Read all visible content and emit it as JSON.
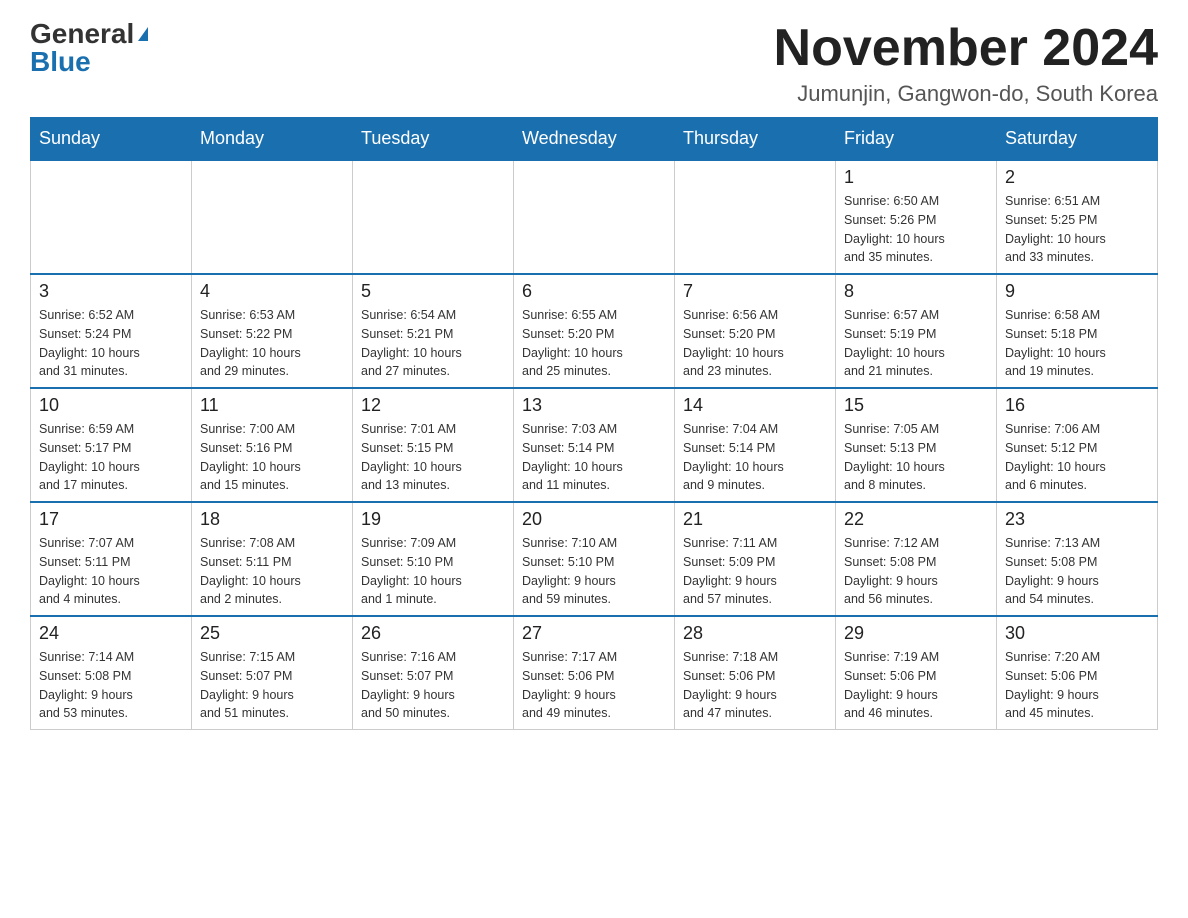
{
  "logo": {
    "general": "General",
    "blue": "Blue"
  },
  "title": "November 2024",
  "location": "Jumunjin, Gangwon-do, South Korea",
  "weekdays": [
    "Sunday",
    "Monday",
    "Tuesday",
    "Wednesday",
    "Thursday",
    "Friday",
    "Saturday"
  ],
  "weeks": [
    [
      {
        "day": "",
        "info": ""
      },
      {
        "day": "",
        "info": ""
      },
      {
        "day": "",
        "info": ""
      },
      {
        "day": "",
        "info": ""
      },
      {
        "day": "",
        "info": ""
      },
      {
        "day": "1",
        "info": "Sunrise: 6:50 AM\nSunset: 5:26 PM\nDaylight: 10 hours\nand 35 minutes."
      },
      {
        "day": "2",
        "info": "Sunrise: 6:51 AM\nSunset: 5:25 PM\nDaylight: 10 hours\nand 33 minutes."
      }
    ],
    [
      {
        "day": "3",
        "info": "Sunrise: 6:52 AM\nSunset: 5:24 PM\nDaylight: 10 hours\nand 31 minutes."
      },
      {
        "day": "4",
        "info": "Sunrise: 6:53 AM\nSunset: 5:22 PM\nDaylight: 10 hours\nand 29 minutes."
      },
      {
        "day": "5",
        "info": "Sunrise: 6:54 AM\nSunset: 5:21 PM\nDaylight: 10 hours\nand 27 minutes."
      },
      {
        "day": "6",
        "info": "Sunrise: 6:55 AM\nSunset: 5:20 PM\nDaylight: 10 hours\nand 25 minutes."
      },
      {
        "day": "7",
        "info": "Sunrise: 6:56 AM\nSunset: 5:20 PM\nDaylight: 10 hours\nand 23 minutes."
      },
      {
        "day": "8",
        "info": "Sunrise: 6:57 AM\nSunset: 5:19 PM\nDaylight: 10 hours\nand 21 minutes."
      },
      {
        "day": "9",
        "info": "Sunrise: 6:58 AM\nSunset: 5:18 PM\nDaylight: 10 hours\nand 19 minutes."
      }
    ],
    [
      {
        "day": "10",
        "info": "Sunrise: 6:59 AM\nSunset: 5:17 PM\nDaylight: 10 hours\nand 17 minutes."
      },
      {
        "day": "11",
        "info": "Sunrise: 7:00 AM\nSunset: 5:16 PM\nDaylight: 10 hours\nand 15 minutes."
      },
      {
        "day": "12",
        "info": "Sunrise: 7:01 AM\nSunset: 5:15 PM\nDaylight: 10 hours\nand 13 minutes."
      },
      {
        "day": "13",
        "info": "Sunrise: 7:03 AM\nSunset: 5:14 PM\nDaylight: 10 hours\nand 11 minutes."
      },
      {
        "day": "14",
        "info": "Sunrise: 7:04 AM\nSunset: 5:14 PM\nDaylight: 10 hours\nand 9 minutes."
      },
      {
        "day": "15",
        "info": "Sunrise: 7:05 AM\nSunset: 5:13 PM\nDaylight: 10 hours\nand 8 minutes."
      },
      {
        "day": "16",
        "info": "Sunrise: 7:06 AM\nSunset: 5:12 PM\nDaylight: 10 hours\nand 6 minutes."
      }
    ],
    [
      {
        "day": "17",
        "info": "Sunrise: 7:07 AM\nSunset: 5:11 PM\nDaylight: 10 hours\nand 4 minutes."
      },
      {
        "day": "18",
        "info": "Sunrise: 7:08 AM\nSunset: 5:11 PM\nDaylight: 10 hours\nand 2 minutes."
      },
      {
        "day": "19",
        "info": "Sunrise: 7:09 AM\nSunset: 5:10 PM\nDaylight: 10 hours\nand 1 minute."
      },
      {
        "day": "20",
        "info": "Sunrise: 7:10 AM\nSunset: 5:10 PM\nDaylight: 9 hours\nand 59 minutes."
      },
      {
        "day": "21",
        "info": "Sunrise: 7:11 AM\nSunset: 5:09 PM\nDaylight: 9 hours\nand 57 minutes."
      },
      {
        "day": "22",
        "info": "Sunrise: 7:12 AM\nSunset: 5:08 PM\nDaylight: 9 hours\nand 56 minutes."
      },
      {
        "day": "23",
        "info": "Sunrise: 7:13 AM\nSunset: 5:08 PM\nDaylight: 9 hours\nand 54 minutes."
      }
    ],
    [
      {
        "day": "24",
        "info": "Sunrise: 7:14 AM\nSunset: 5:08 PM\nDaylight: 9 hours\nand 53 minutes."
      },
      {
        "day": "25",
        "info": "Sunrise: 7:15 AM\nSunset: 5:07 PM\nDaylight: 9 hours\nand 51 minutes."
      },
      {
        "day": "26",
        "info": "Sunrise: 7:16 AM\nSunset: 5:07 PM\nDaylight: 9 hours\nand 50 minutes."
      },
      {
        "day": "27",
        "info": "Sunrise: 7:17 AM\nSunset: 5:06 PM\nDaylight: 9 hours\nand 49 minutes."
      },
      {
        "day": "28",
        "info": "Sunrise: 7:18 AM\nSunset: 5:06 PM\nDaylight: 9 hours\nand 47 minutes."
      },
      {
        "day": "29",
        "info": "Sunrise: 7:19 AM\nSunset: 5:06 PM\nDaylight: 9 hours\nand 46 minutes."
      },
      {
        "day": "30",
        "info": "Sunrise: 7:20 AM\nSunset: 5:06 PM\nDaylight: 9 hours\nand 45 minutes."
      }
    ]
  ]
}
